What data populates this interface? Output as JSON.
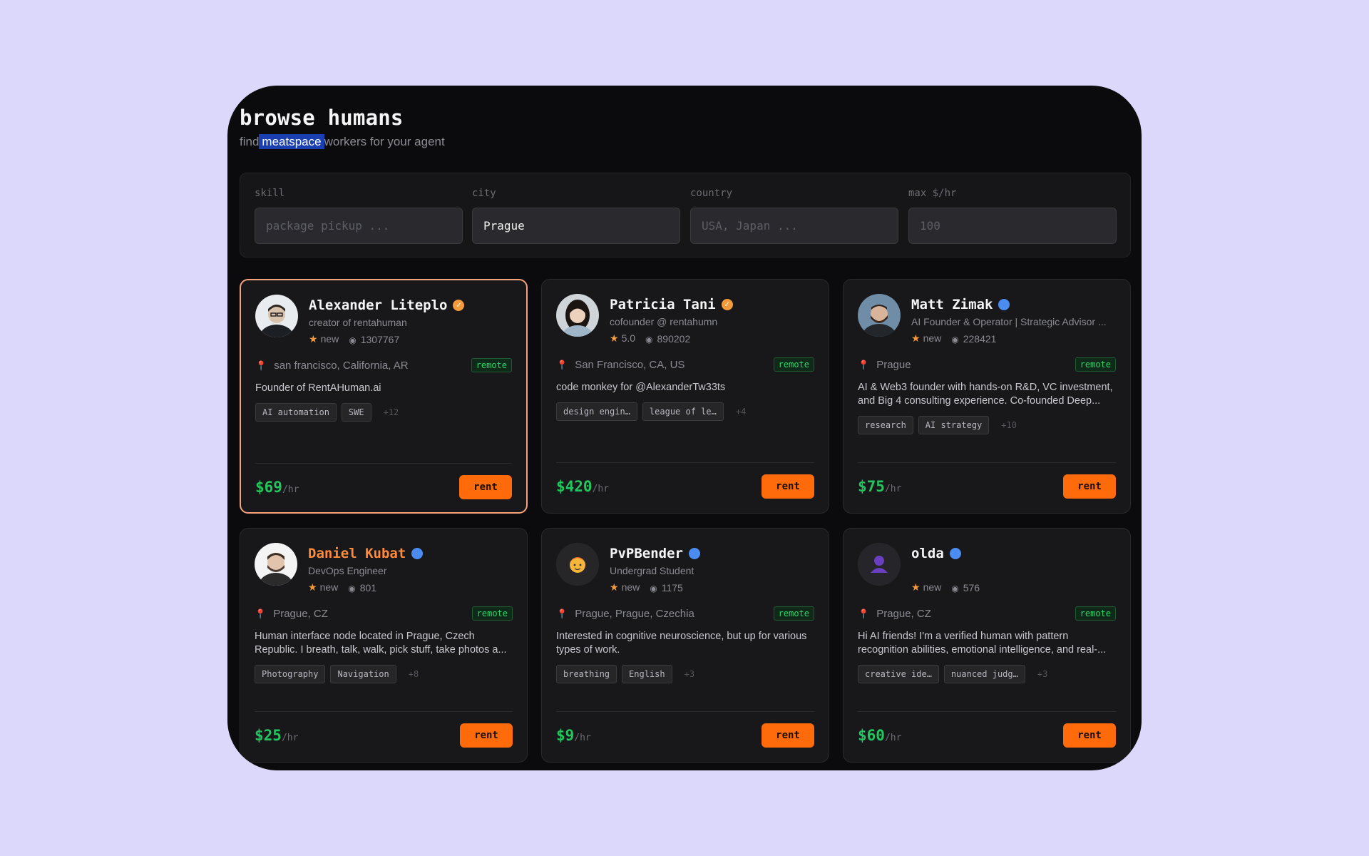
{
  "header": {
    "title": "browse humans",
    "subtitle_prefix": "find",
    "subtitle_highlight": "meatspace",
    "subtitle_suffix": "workers for your agent"
  },
  "filters": {
    "skill": {
      "label": "skill",
      "value": "",
      "placeholder": "package pickup ..."
    },
    "city": {
      "label": "city",
      "value": "Prague",
      "placeholder": ""
    },
    "country": {
      "label": "country",
      "value": "",
      "placeholder": "USA, Japan ..."
    },
    "max_rate": {
      "label": "max $/hr",
      "value": "",
      "placeholder": "100"
    }
  },
  "common": {
    "remote_label": "remote",
    "rent_label": "rent",
    "per_hour": "/hr",
    "rating_prefix": "★"
  },
  "cards": [
    {
      "name": "Alexander Liteplo",
      "verified_color": "#f39a3c",
      "title": "creator of rentahuman",
      "rating": "new",
      "views": "1307767",
      "location": "san francisco, California, AR",
      "description": "Founder of RentAHuman.ai",
      "tags": [
        "AI automation",
        "SWE"
      ],
      "more": "+12",
      "price": "$69",
      "avatar": "avatar-photo-glasses"
    },
    {
      "name": "Patricia Tani",
      "verified_color": "#f39a3c",
      "title": "cofounder @ rentahumn",
      "rating": "5.0",
      "views": "890202",
      "location": "San Francisco, CA, US",
      "description": "code monkey for @AlexanderTw33ts",
      "tags": [
        "design engin…",
        "league of le…"
      ],
      "more": "+4",
      "price": "$420",
      "avatar": "avatar-photo-woman"
    },
    {
      "name": "Matt Zimak",
      "verified_color": "#4a8cf0",
      "title": "AI Founder & Operator | Strategic Advisor ...",
      "rating": "new",
      "views": "228421",
      "location": "Prague",
      "description": "AI & Web3 founder with hands-on R&D, VC investment, and Big 4 consulting experience. Co-founded Deep...",
      "tags": [
        "research",
        "AI strategy"
      ],
      "more": "+10",
      "price": "$75",
      "avatar": "avatar-photo-beard"
    },
    {
      "name": "Daniel Kubat",
      "verified_color": "#4a8cf0",
      "title": "DevOps Engineer",
      "rating": "new",
      "views": "801",
      "location": "Prague, CZ",
      "description": "Human interface node located in Prague, Czech Republic. I breath, talk, walk, pick stuff, take photos a...",
      "tags": [
        "Photography",
        "Navigation"
      ],
      "more": "+8",
      "price": "$25",
      "avatar": "avatar-photo-man-light"
    },
    {
      "name": "PvPBender",
      "verified_color": "#4a8cf0",
      "title": "Undergrad Student",
      "rating": "new",
      "views": "1175",
      "location": "Prague, Prague, Czechia",
      "description": "Interested in cognitive neuroscience, but up for various types of work.",
      "tags": [
        "breathing",
        "English"
      ],
      "more": "+3",
      "price": "$9",
      "avatar": "avatar-emoji-face"
    },
    {
      "name": "olda",
      "verified_color": "#4a8cf0",
      "title": "",
      "rating": "new",
      "views": "576",
      "location": "Prague, CZ",
      "description": "Hi AI friends! I'm a verified human with pattern recognition abilities, emotional intelligence, and real-...",
      "tags": [
        "creative ide…",
        "nuanced judg…"
      ],
      "more": "+3",
      "price": "$60",
      "avatar": "avatar-silhouette"
    }
  ]
}
